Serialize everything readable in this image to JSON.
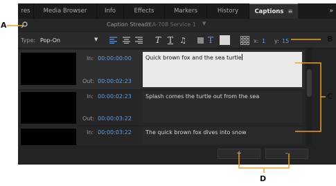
{
  "tabs": [
    {
      "label": "res",
      "active": false
    },
    {
      "label": "Media Browser",
      "active": false
    },
    {
      "label": "Info",
      "active": false
    },
    {
      "label": "Effects",
      "active": false
    },
    {
      "label": "Markers",
      "active": false
    },
    {
      "label": "History",
      "active": false
    },
    {
      "label": "Captions",
      "active": true
    }
  ],
  "tab_menu_icon": "≡",
  "tab_overflow_icon": "»",
  "caption_stream": {
    "label": "Caption Stream:",
    "value": "CEA-708 Service 1"
  },
  "type": {
    "label": "Type:",
    "value": "Pop-On"
  },
  "position": {
    "x_label": "x:",
    "x_value": "1",
    "y_label": "y:",
    "y_value": "15"
  },
  "captions": [
    {
      "in_label": "In:",
      "in": "00:00:00:00",
      "out_label": "Out:",
      "out": "00:00:02:23",
      "text": "Quick brown fox and the sea turtle",
      "selected": true
    },
    {
      "in_label": "In:",
      "in": "00:00:02:23",
      "out_label": "Out:",
      "out": "00:00:03:22",
      "text": "Splash comes the turtle out from the sea",
      "selected": false
    },
    {
      "in_label": "In:",
      "in": "00:00:03:22",
      "text": "The quick brown fox dives into snow",
      "selected": false
    }
  ],
  "buttons": {
    "add": "+",
    "remove": "–"
  },
  "callouts": {
    "a": "A",
    "b": "B",
    "c": "C",
    "d": "D"
  },
  "colors": {
    "accent": "#5aa0e6",
    "panel": "#232323",
    "callout_line": "#f0a020"
  }
}
